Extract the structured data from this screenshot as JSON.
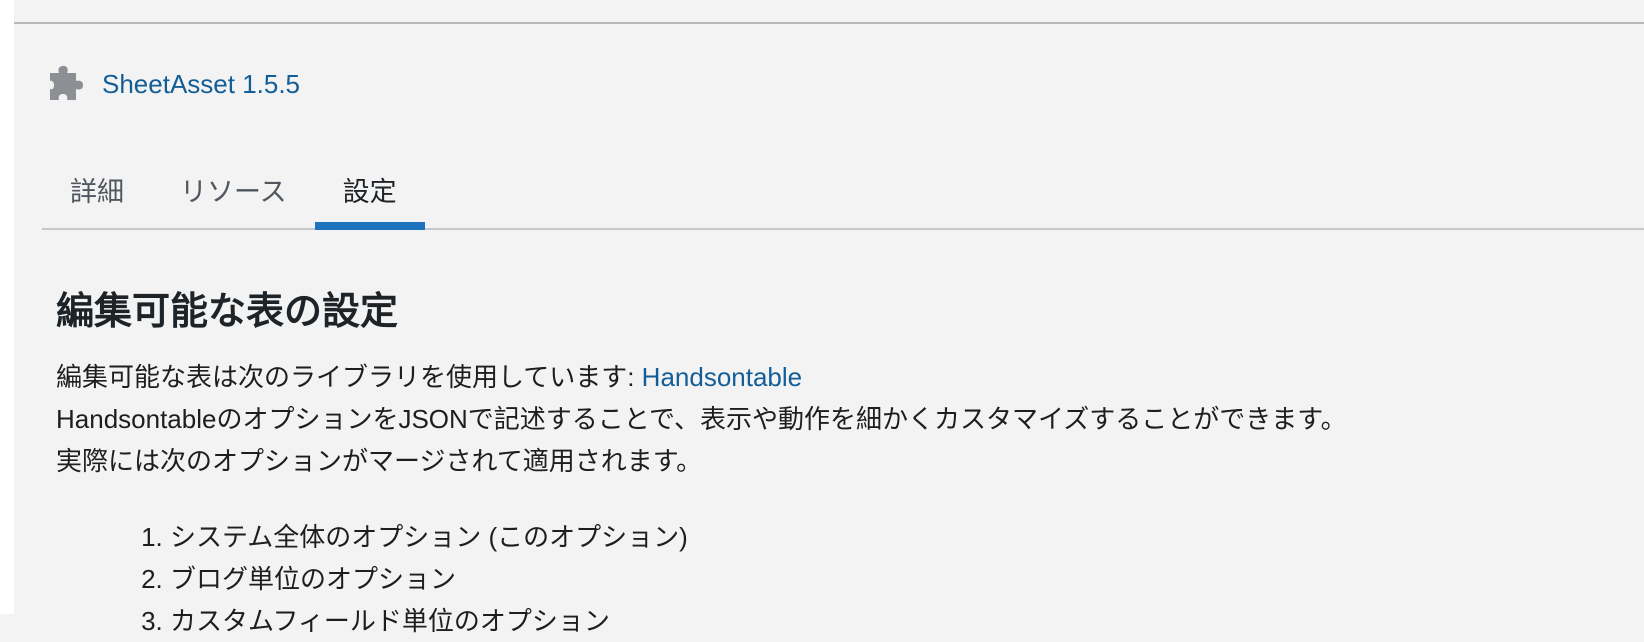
{
  "plugin": {
    "icon": "puzzle-piece-icon",
    "name": "SheetAsset 1.5.5"
  },
  "tabs": [
    {
      "label": "詳細",
      "active": false
    },
    {
      "label": "リソース",
      "active": false
    },
    {
      "label": "設定",
      "active": true
    }
  ],
  "section": {
    "title": "編集可能な表の設定",
    "intro_prefix": "編集可能な表は次のライブラリを使用しています: ",
    "intro_link": "Handsontable",
    "line2": "HandsontableのオプションをJSONで記述することで、表示や動作を細かくカスタマイズすることができます。",
    "line3": "実際には次のオプションがマージされて適用されます。",
    "merge_order": [
      "システム全体のオプション (このオプション)",
      "ブログ単位のオプション",
      "カスタムフィールド単位のオプション"
    ]
  },
  "colors": {
    "link": "#135e96",
    "tab_active_indicator": "#1e73be",
    "background": "#f3f3f3",
    "icon": "#8c8f94"
  }
}
